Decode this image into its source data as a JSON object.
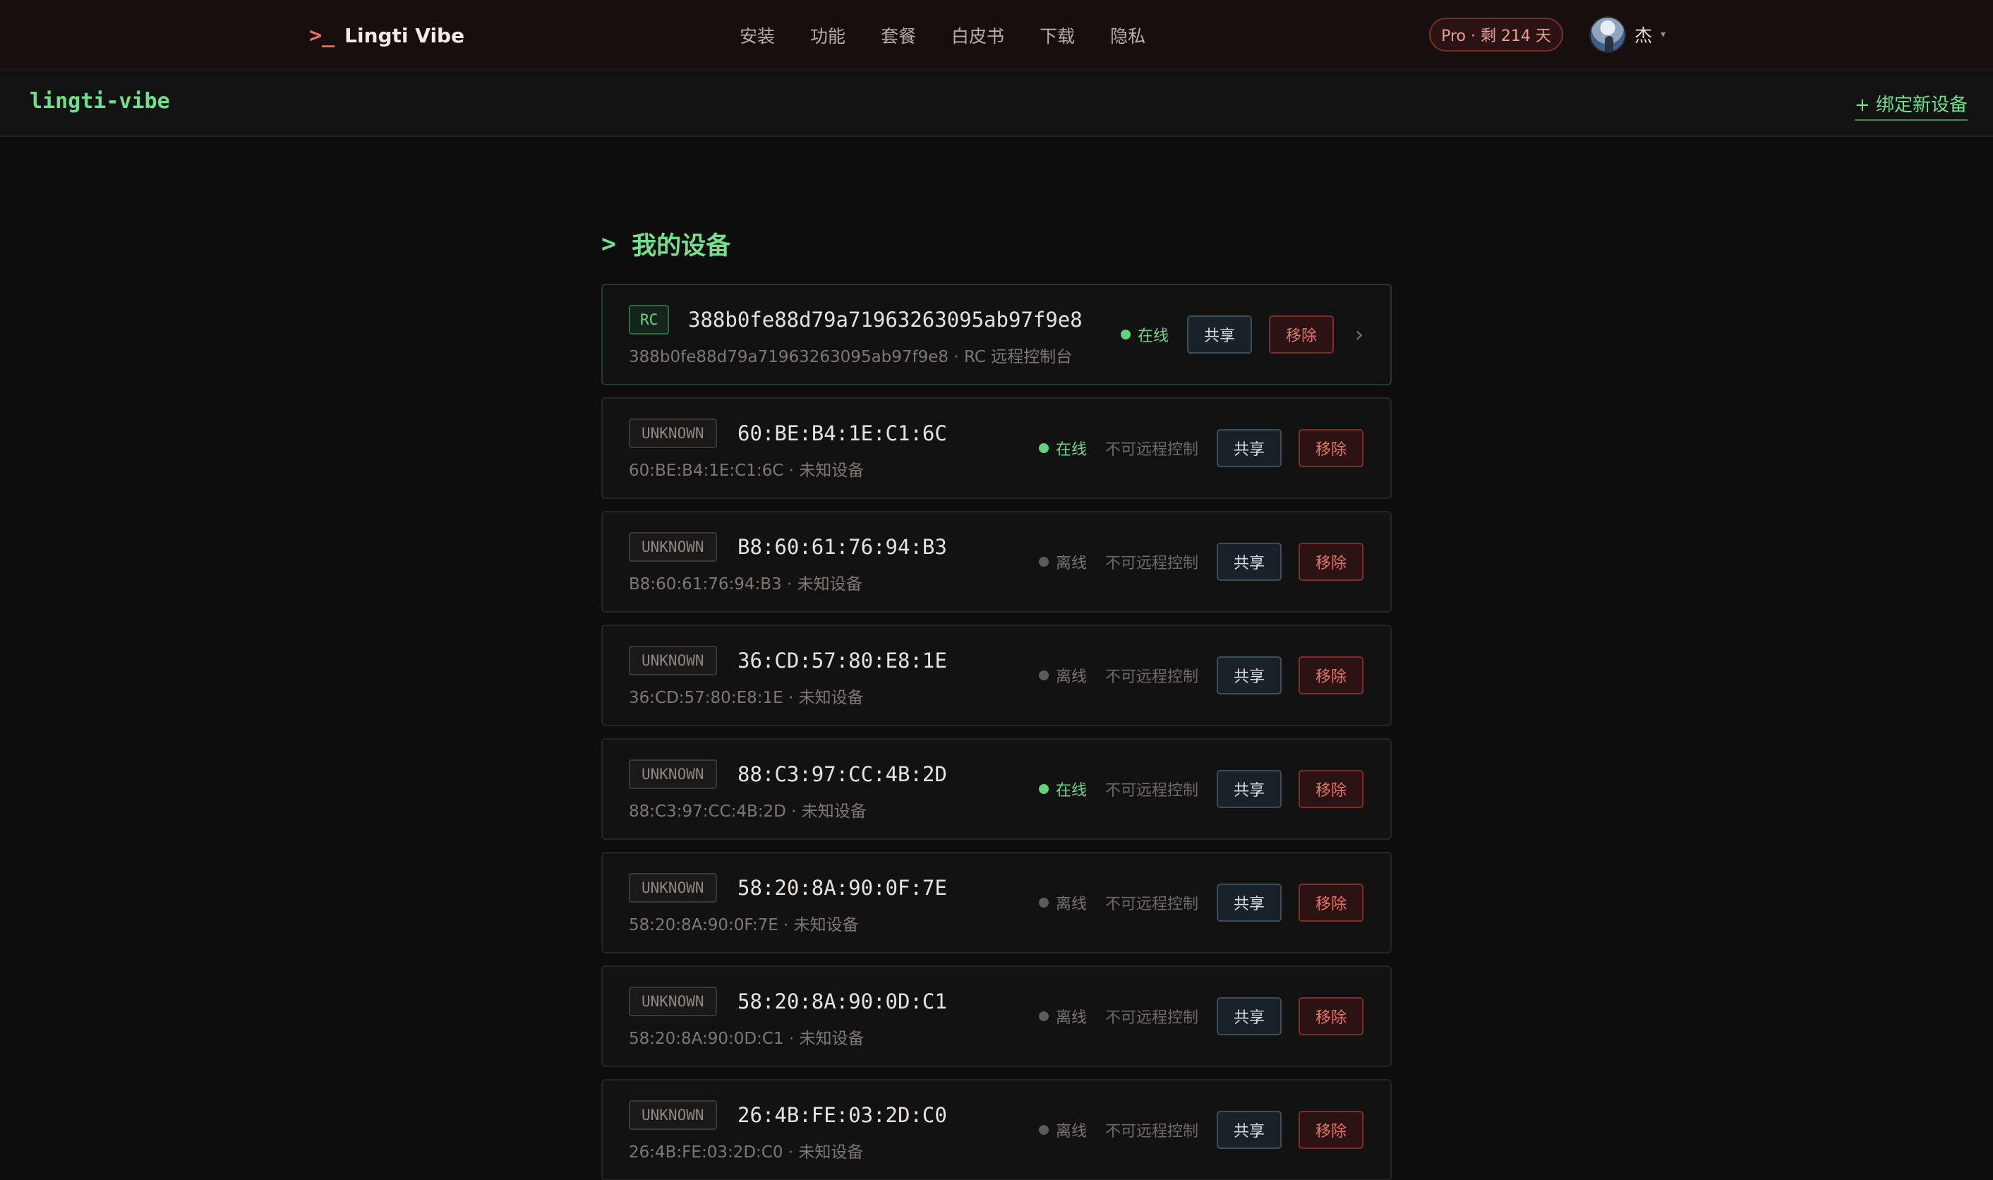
{
  "brand": {
    "prompt": ">_",
    "name": "Lingti Vibe"
  },
  "nav": [
    "安装",
    "功能",
    "套餐",
    "白皮书",
    "下载",
    "隐私"
  ],
  "pro_badge": "Pro · 剩 214 天",
  "user": {
    "name": "杰",
    "caret": "▾"
  },
  "subbar": {
    "project": "lingti-vibe",
    "bind_label": "+ 绑定新设备"
  },
  "section": {
    "prompt": ">",
    "title": "我的设备"
  },
  "devices": [
    {
      "tag": "RC",
      "name": "388b0fe88d79a71963263095ab97f9e8",
      "sub": "388b0fe88d79a71963263095ab97f9e8 · RC 远程控制台",
      "status": "在线",
      "online": true,
      "remote_note": "",
      "share": "共享",
      "remove": "移除",
      "chevron": "›"
    },
    {
      "tag": "UNKNOWN",
      "name": "60:BE:B4:1E:C1:6C",
      "sub": "60:BE:B4:1E:C1:6C · 未知设备",
      "status": "在线",
      "online": true,
      "remote_note": "不可远程控制",
      "share": "共享",
      "remove": "移除"
    },
    {
      "tag": "UNKNOWN",
      "name": "B8:60:61:76:94:B3",
      "sub": "B8:60:61:76:94:B3 · 未知设备",
      "status": "离线",
      "online": false,
      "remote_note": "不可远程控制",
      "share": "共享",
      "remove": "移除"
    },
    {
      "tag": "UNKNOWN",
      "name": "36:CD:57:80:E8:1E",
      "sub": "36:CD:57:80:E8:1E · 未知设备",
      "status": "离线",
      "online": false,
      "remote_note": "不可远程控制",
      "share": "共享",
      "remove": "移除"
    },
    {
      "tag": "UNKNOWN",
      "name": "88:C3:97:CC:4B:2D",
      "sub": "88:C3:97:CC:4B:2D · 未知设备",
      "status": "在线",
      "online": true,
      "remote_note": "不可远程控制",
      "share": "共享",
      "remove": "移除"
    },
    {
      "tag": "UNKNOWN",
      "name": "58:20:8A:90:0F:7E",
      "sub": "58:20:8A:90:0F:7E · 未知设备",
      "status": "离线",
      "online": false,
      "remote_note": "不可远程控制",
      "share": "共享",
      "remove": "移除"
    },
    {
      "tag": "UNKNOWN",
      "name": "58:20:8A:90:0D:C1",
      "sub": "58:20:8A:90:0D:C1 · 未知设备",
      "status": "离线",
      "online": false,
      "remote_note": "不可远程控制",
      "share": "共享",
      "remove": "移除"
    },
    {
      "tag": "UNKNOWN",
      "name": "26:4B:FE:03:2D:C0",
      "sub": "26:4B:FE:03:2D:C0 · 未知设备",
      "status": "离线",
      "online": false,
      "remote_note": "不可远程控制",
      "share": "共享",
      "remove": "移除"
    }
  ]
}
